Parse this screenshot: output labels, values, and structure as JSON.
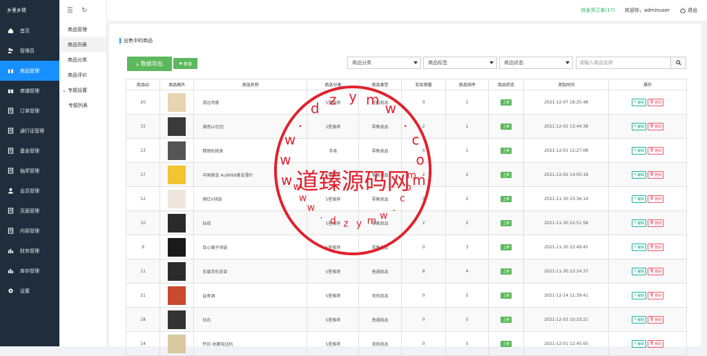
{
  "app": {
    "title": "乡里乡情"
  },
  "sidebar": {
    "items": [
      {
        "label": "首页",
        "icon": "home-icon"
      },
      {
        "label": "管理员",
        "icon": "users-icon"
      },
      {
        "label": "商品管理",
        "icon": "gift-icon",
        "active": true
      },
      {
        "label": "商铺管理",
        "icon": "gift-icon"
      },
      {
        "label": "订单管理",
        "icon": "list-icon"
      },
      {
        "label": "通行证管理",
        "icon": "list-icon"
      },
      {
        "label": "基金管理",
        "icon": "list-icon"
      },
      {
        "label": "抽奖管理",
        "icon": "list-icon"
      },
      {
        "label": "会员管理",
        "icon": "user-icon"
      },
      {
        "label": "页面管理",
        "icon": "list-icon"
      },
      {
        "label": "内容管理",
        "icon": "list-icon"
      },
      {
        "label": "财务管理",
        "icon": "chart-icon"
      },
      {
        "label": "库存管理",
        "icon": "chart-icon"
      },
      {
        "label": "设置",
        "icon": "gear-icon"
      }
    ]
  },
  "subnav": {
    "title": "商品管理",
    "items": [
      {
        "label": "商品列表",
        "active": true
      },
      {
        "label": "商品分类"
      },
      {
        "label": "商品评价"
      },
      {
        "label": "专题设置",
        "expandable": true
      },
      {
        "label": "专题列表",
        "indent": true
      }
    ]
  },
  "header": {
    "pending_label": "待发货订单",
    "pending_count": "(17)",
    "welcome": "欢迎你，adminuser",
    "logout": "退出"
  },
  "panel": {
    "title": "出售中的商品"
  },
  "toolbar": {
    "export_label": "数据导出",
    "add_label": "新增",
    "category_select": "商品分类",
    "tag_select": "商品标签",
    "status_select": "商品状态",
    "search_placeholder": "请输入商品名称"
  },
  "table": {
    "headers": [
      "商品ID",
      "商品图片",
      "商品名称",
      "商品分类",
      "商品类型",
      "实际销量",
      "商品排序",
      "商品状态",
      "添加时间",
      "操作"
    ],
    "rows": [
      {
        "id": "20",
        "name": "清远鸡蛋",
        "category": "5星推荐",
        "type": "竞拍商品",
        "sales": "0",
        "sort": "1",
        "status": "上架",
        "time": "2021-12-07 18:25:48",
        "thumb": "#e8d4b0"
      },
      {
        "id": "15",
        "name": "满意LV包包",
        "category": "5星推荐",
        "type": "零售商品",
        "sales": "2",
        "sort": "1",
        "status": "上架",
        "time": "2021-12-02 13:44:38",
        "thumb": "#3a3a3a"
      },
      {
        "id": "13",
        "name": "精钢机械表",
        "category": "手表",
        "type": "零售商品",
        "sales": "0",
        "sort": "1",
        "status": "上架",
        "time": "2021-12-01 12:27:08",
        "thumb": "#555555"
      },
      {
        "id": "17",
        "name": "中国黄金 Au9999黄金薄片",
        "category": "5星推荐",
        "type": "零售商品",
        "sales": "2",
        "sort": "2",
        "status": "上架",
        "time": "2021-12-02 14:05:18",
        "thumb": "#f2c430"
      },
      {
        "id": "12",
        "name": "网红V项链",
        "category": "5星推荐",
        "type": "零售商品",
        "sales": "0",
        "sort": "2",
        "status": "上架",
        "time": "2021-11-30 23:36:14",
        "thumb": "#efe6dd"
      },
      {
        "id": "10",
        "name": "钻戒",
        "category": "5星推荐",
        "type": "零售商品",
        "sales": "2",
        "sort": "2",
        "status": "上架",
        "time": "2021-11-30 22:51:58",
        "thumb": "#2a2a2a"
      },
      {
        "id": "9",
        "name": "双心蝴子项链",
        "category": "5星推荐",
        "type": "零售商品",
        "sales": "0",
        "sort": "3",
        "status": "上架",
        "time": "2021-11-30 22:49:45",
        "thumb": "#1a1a1a"
      },
      {
        "id": "11",
        "name": "车载手机支架",
        "category": "5星推荐",
        "type": "普通商品",
        "sales": "8",
        "sort": "4",
        "status": "上架",
        "time": "2021-11-30 23:24:37",
        "thumb": "#2b2b2b"
      },
      {
        "id": "21",
        "name": "益寿酒",
        "category": "5星推荐",
        "type": "竞拍商品",
        "sales": "0",
        "sort": "5",
        "status": "上架",
        "time": "2021-12-14 11:39:41",
        "thumb": "#c94a2e"
      },
      {
        "id": "18",
        "name": "钻石",
        "category": "5星推荐",
        "type": "普通商品",
        "sales": "0",
        "sort": "5",
        "status": "上架",
        "time": "2021-12-03 10:33:21",
        "thumb": "#333333"
      },
      {
        "id": "14",
        "name": "怀旧 收藏电话机",
        "category": "5星推荐",
        "type": "竞拍商品",
        "sales": "0",
        "sort": "5",
        "status": "上架",
        "time": "2021-12-01 12:45:05",
        "thumb": "#d9c9a0"
      }
    ],
    "edit_label": "编辑",
    "delete_label": "删除"
  },
  "watermark": {
    "text": "道臻源码网",
    "url_top": "www.dzymw.com",
    "url_bottom": "www.dzymw.com",
    "color": "#e0212d"
  },
  "colors": {
    "sidebar_bg": "#1f2d3d",
    "active": "#1890ff",
    "green": "#5cb85c"
  }
}
